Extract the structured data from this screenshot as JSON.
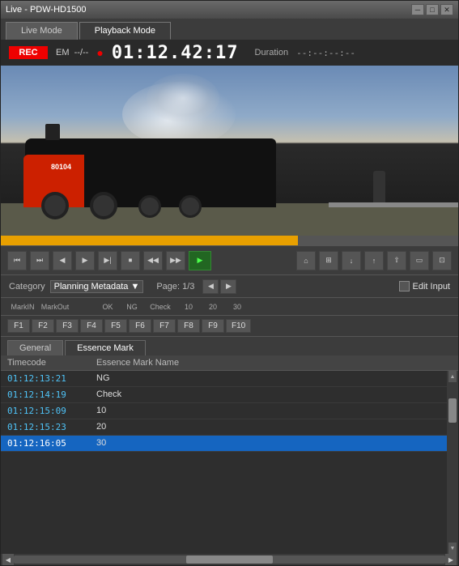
{
  "window": {
    "title": "Live - PDW-HD1500",
    "minimize": "─",
    "maximize": "□",
    "close": "✕"
  },
  "tabs": [
    {
      "id": "live",
      "label": "Live Mode",
      "active": false
    },
    {
      "id": "playback",
      "label": "Playback Mode",
      "active": true
    }
  ],
  "status": {
    "rec_label": "REC",
    "em_label": "EM",
    "separator": "--/--",
    "dot": "●",
    "timecode": "01:12.42:17",
    "duration_label": "Duration",
    "duration_value": "--:--:--:--"
  },
  "controls": {
    "buttons": [
      "⏮",
      "⏭",
      "◀",
      "▶",
      "▶|",
      "⏹",
      "◀◀",
      "▶▶"
    ],
    "play_label": "▶",
    "right_buttons": [
      "⌂",
      "⊞",
      "↧",
      "↥",
      "⇧",
      "▭"
    ]
  },
  "category": {
    "label": "Category",
    "value": "Planning Metadata",
    "dropdown_arrow": "▼",
    "page_label": "Page: 1/3",
    "prev_arrow": "◀",
    "next_arrow": "▶",
    "edit_input_label": "Edit Input"
  },
  "function_keys": {
    "headers": [
      "MarkIN",
      "MarkOut",
      "",
      "OK",
      "NG",
      "Check",
      "10",
      "20",
      "30"
    ],
    "keys": [
      "F1",
      "F2",
      "F3",
      "F4",
      "F5",
      "F6",
      "F7",
      "F8",
      "F9",
      "F10"
    ]
  },
  "sub_tabs": [
    {
      "id": "general",
      "label": "General",
      "active": false
    },
    {
      "id": "essence_mark",
      "label": "Essence Mark",
      "active": true
    }
  ],
  "table": {
    "headers": [
      {
        "id": "timecode",
        "label": "Timecode"
      },
      {
        "id": "name",
        "label": "Essence Mark Name"
      }
    ],
    "rows": [
      {
        "timecode": "01:12:13:21",
        "name": "NG",
        "selected": false
      },
      {
        "timecode": "01:12:14:19",
        "name": "Check",
        "selected": false
      },
      {
        "timecode": "01:12:15:09",
        "name": "10",
        "selected": false
      },
      {
        "timecode": "01:12:15:23",
        "name": "20",
        "selected": false
      },
      {
        "timecode": "01:12:16:05",
        "name": "30",
        "selected": true
      }
    ]
  }
}
